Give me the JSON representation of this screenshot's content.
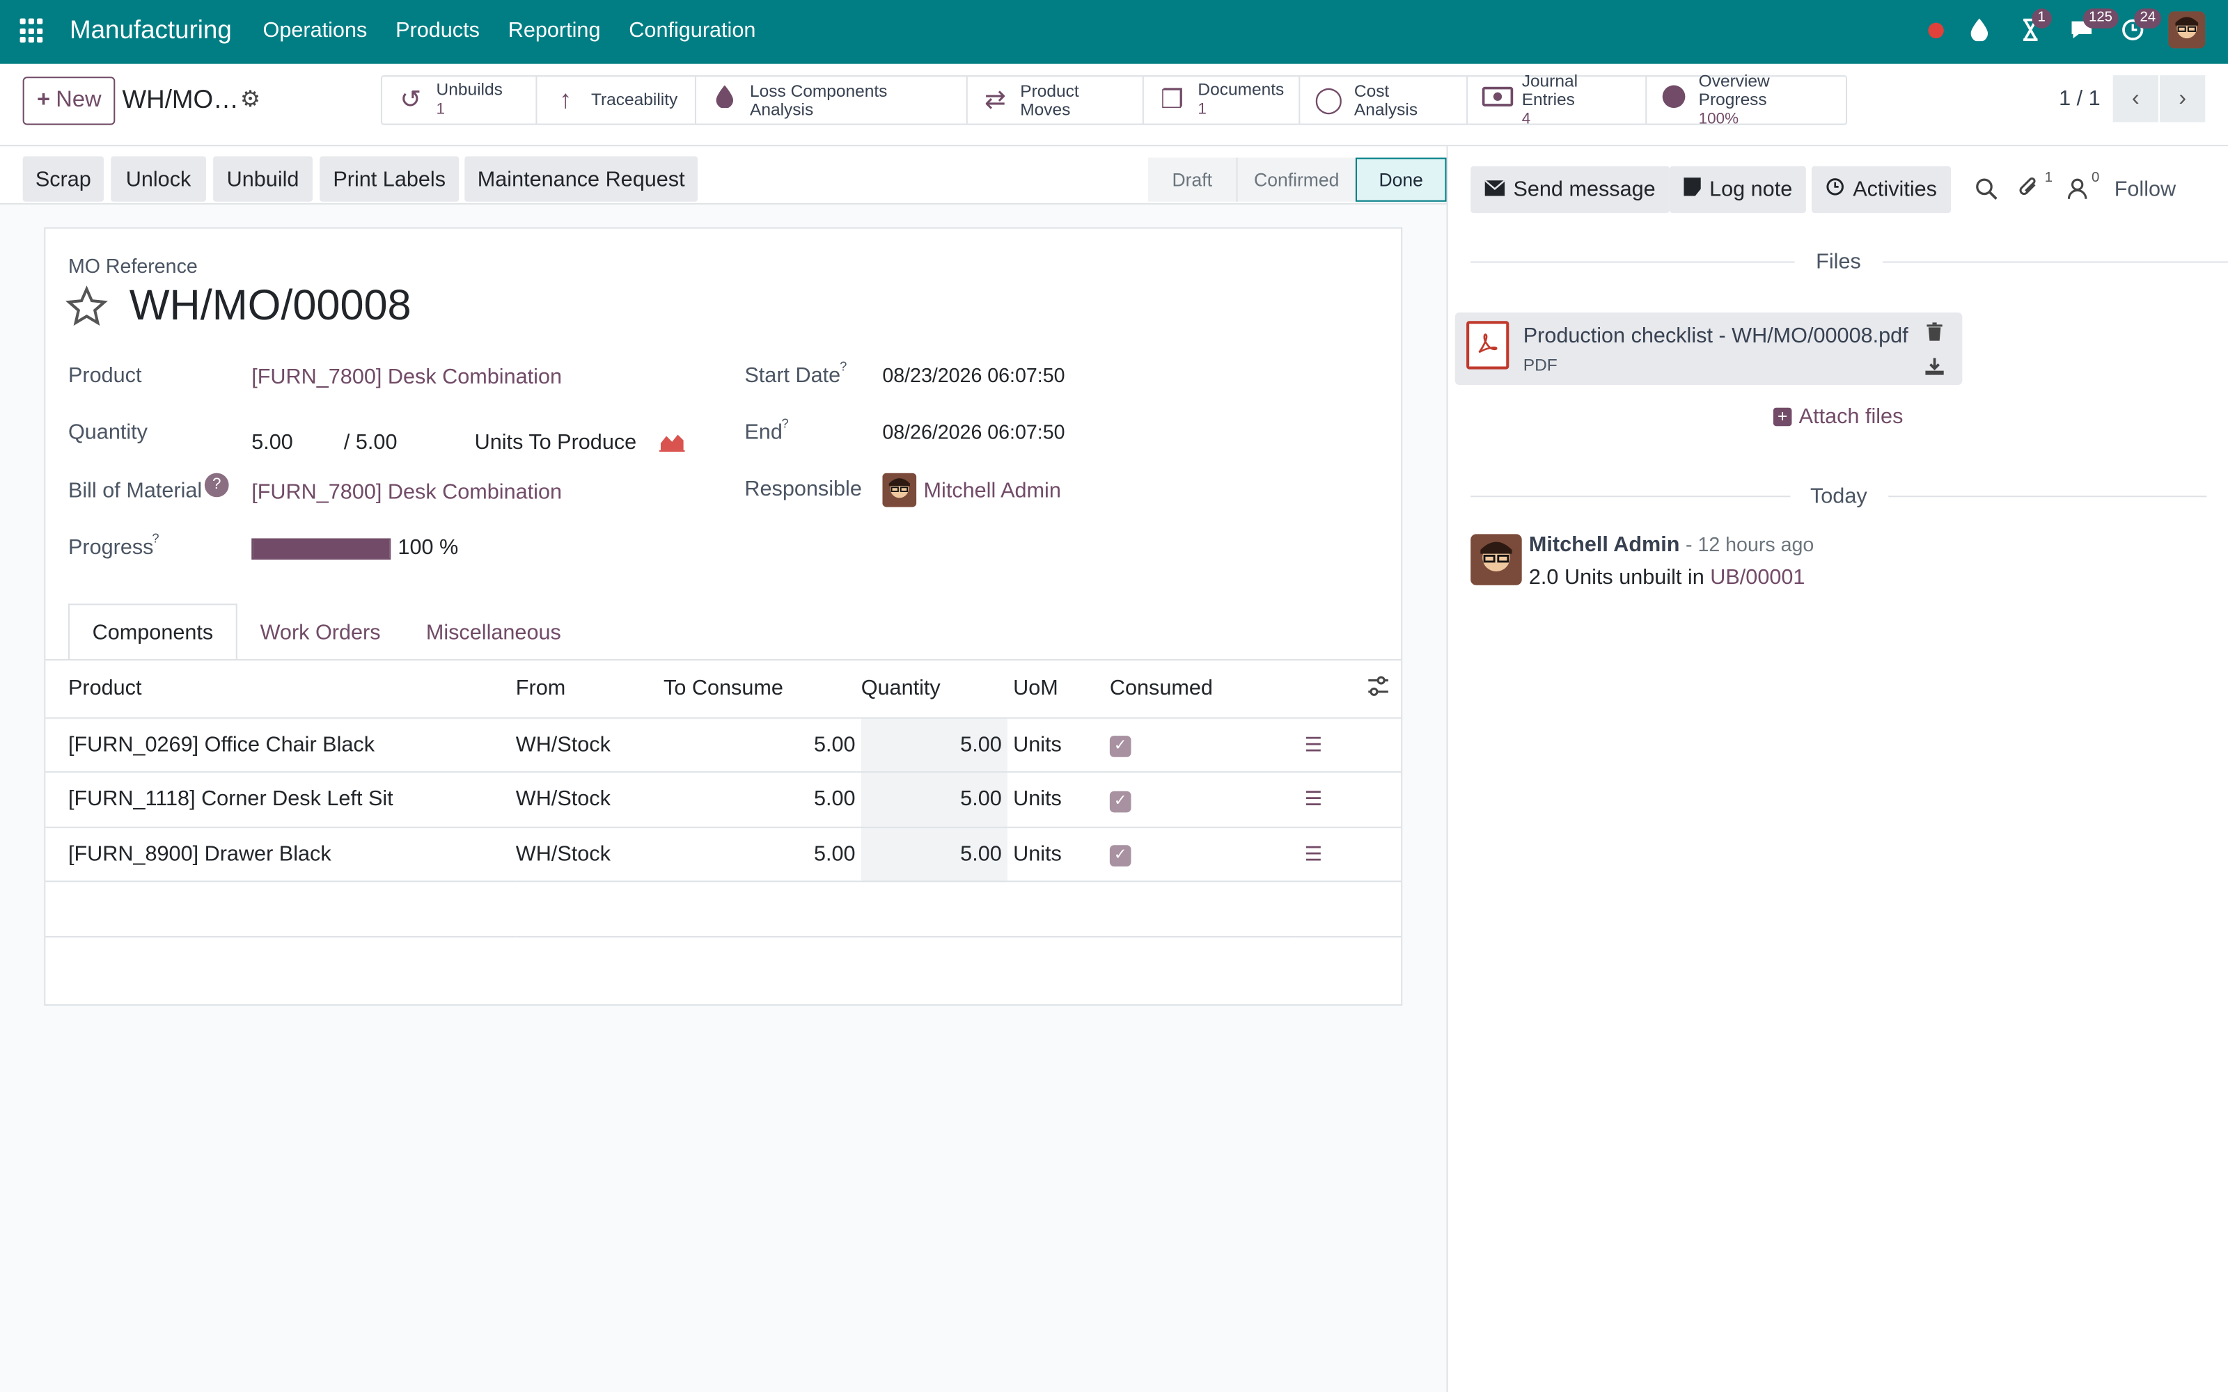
{
  "navbar": {
    "app_name": "Manufacturing",
    "menu": [
      "Operations",
      "Products",
      "Reporting",
      "Configuration"
    ],
    "badges": {
      "activities": "1",
      "messages": "125",
      "updates": "24"
    },
    "accent": "#017e84"
  },
  "control": {
    "new_label": "New",
    "breadcrumb": "WH/MO…",
    "pager": "1 / 1",
    "smart_buttons": [
      {
        "label": "Unbuilds",
        "count": "1",
        "icon": "undo-icon"
      },
      {
        "label": "Traceability",
        "count": "",
        "icon": "arrow-up-icon"
      },
      {
        "label": "Loss Components Analysis",
        "count": "",
        "icon": "drop-icon"
      },
      {
        "label": "Product Moves",
        "count": "",
        "icon": "exchange-icon"
      },
      {
        "label": "Documents",
        "count": "1",
        "icon": "files-icon"
      },
      {
        "label": "Cost Analysis",
        "count": "",
        "icon": "circle-icon"
      },
      {
        "label": "Journal Entries",
        "count": "4",
        "icon": "money-icon"
      },
      {
        "label": "Overview Progress",
        "count": "100%",
        "icon": "pie-icon"
      }
    ]
  },
  "actions": {
    "scrap": "Scrap",
    "unlock": "Unlock",
    "unbuild": "Unbuild",
    "print_labels": "Print Labels",
    "maintenance": "Maintenance Request"
  },
  "stages": {
    "draft": "Draft",
    "confirmed": "Confirmed",
    "done": "Done"
  },
  "form": {
    "ref_label": "MO Reference",
    "reference": "WH/MO/00008",
    "product_label": "Product",
    "product": "[FURN_7800] Desk Combination",
    "quantity_label": "Quantity",
    "qty_produced": "5.00",
    "qty_total": "/ 5.00",
    "uom_label": "Units To Produce",
    "bom_label": "Bill of Material",
    "bom": "[FURN_7800] Desk Combination",
    "progress_label": "Progress",
    "progress_value": 100,
    "progress_text": "100 %",
    "start_label": "Start Date",
    "start": "08/23/2026 06:07:50",
    "end_label": "End",
    "end": "08/26/2026 06:07:50",
    "responsible_label": "Responsible",
    "responsible": "Mitchell Admin",
    "help_mark": "?"
  },
  "tabs": [
    "Components",
    "Work Orders",
    "Miscellaneous"
  ],
  "table": {
    "headers": [
      "Product",
      "From",
      "To Consume",
      "Quantity",
      "UoM",
      "Consumed"
    ],
    "rows": [
      {
        "product": "[FURN_0269] Office Chair Black",
        "from": "WH/Stock",
        "to_consume": "5.00",
        "quantity": "5.00",
        "uom": "Units"
      },
      {
        "product": "[FURN_1118] Corner Desk Left Sit",
        "from": "WH/Stock",
        "to_consume": "5.00",
        "quantity": "5.00",
        "uom": "Units"
      },
      {
        "product": "[FURN_8900] Drawer Black",
        "from": "WH/Stock",
        "to_consume": "5.00",
        "quantity": "5.00",
        "uom": "Units"
      }
    ]
  },
  "chatter": {
    "send_message": "Send message",
    "log_note": "Log note",
    "activities": "Activities",
    "attachments_count": "1",
    "followers_count": "0",
    "follow": "Follow",
    "files_label": "Files",
    "file_name": "Production checklist - WH/MO/00008.pdf",
    "file_type": "PDF",
    "attach_files": "Attach files",
    "today_label": "Today",
    "author": "Mitchell Admin",
    "time": "- 12 hours ago",
    "message_prefix": "2.0 Units unbuilt in",
    "message_link": "UB/00001"
  }
}
